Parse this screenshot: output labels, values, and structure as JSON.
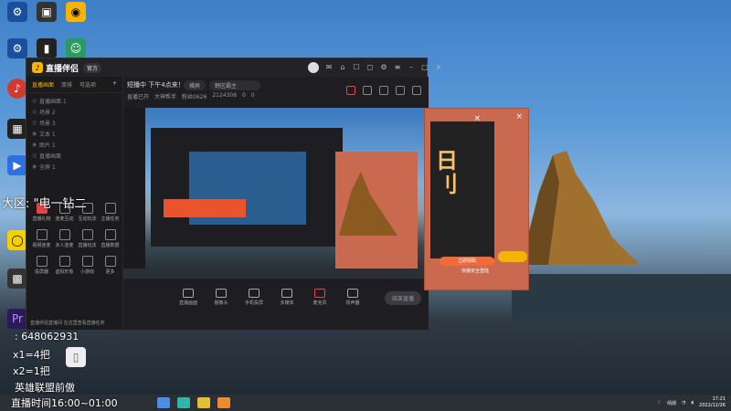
{
  "app": {
    "name": "直播伴侣",
    "badge": "官方"
  },
  "left_panel": {
    "tabs": [
      "直播画面",
      "双排",
      "可选项"
    ],
    "scenes": [
      {
        "label": "直播画面 1"
      },
      {
        "label": "场景 2"
      },
      {
        "label": "场景 3"
      },
      {
        "label": "文本 1"
      },
      {
        "label": "图片 1"
      },
      {
        "label": "直播画面"
      },
      {
        "label": "全屏 1"
      }
    ],
    "tools": [
      {
        "label": "直播礼物"
      },
      {
        "label": "连麦互动"
      },
      {
        "label": "互动玩法"
      },
      {
        "label": "主播任务"
      },
      {
        "label": "视频连麦"
      },
      {
        "label": "多人连麦"
      },
      {
        "label": "直播玩法"
      },
      {
        "label": "直播数据"
      },
      {
        "label": "投屏器"
      },
      {
        "label": "虚拟形象"
      },
      {
        "label": "小游戏"
      },
      {
        "label": "更多"
      }
    ],
    "footer": "直播伴侣直播间 在这里查看直播任务"
  },
  "main": {
    "status_line": "短播中 下午4点来！！",
    "status_pill_1": "横屏",
    "status_pill_2": "野区霸主",
    "status_row": [
      "直播已开",
      "大神帮手",
      "粉丝0626",
      "2124308",
      "0",
      "0"
    ]
  },
  "bottom_tools": [
    {
      "label": "直播画面"
    },
    {
      "label": "摄像头"
    },
    {
      "label": "手机投屏"
    },
    {
      "label": "多媒体"
    },
    {
      "label": "麦克风"
    },
    {
      "label": "扬声器"
    }
  ],
  "start_button": "结束直播",
  "popup": {
    "big_text": "日\n刂",
    "cta": "立即领取",
    "footer": "快播安全登陆"
  },
  "overlays": {
    "region": "大区: \"电一钻二",
    "contact": ": 648062931",
    "x1": "x1=4把",
    "x2": "x2=1把",
    "league": "英雄联盟前傲",
    "schedule": "直播时间16:00~01:00"
  },
  "taskbar": {
    "time": "17:21",
    "date": "2022/12/26",
    "tray_text": "晴朗"
  }
}
